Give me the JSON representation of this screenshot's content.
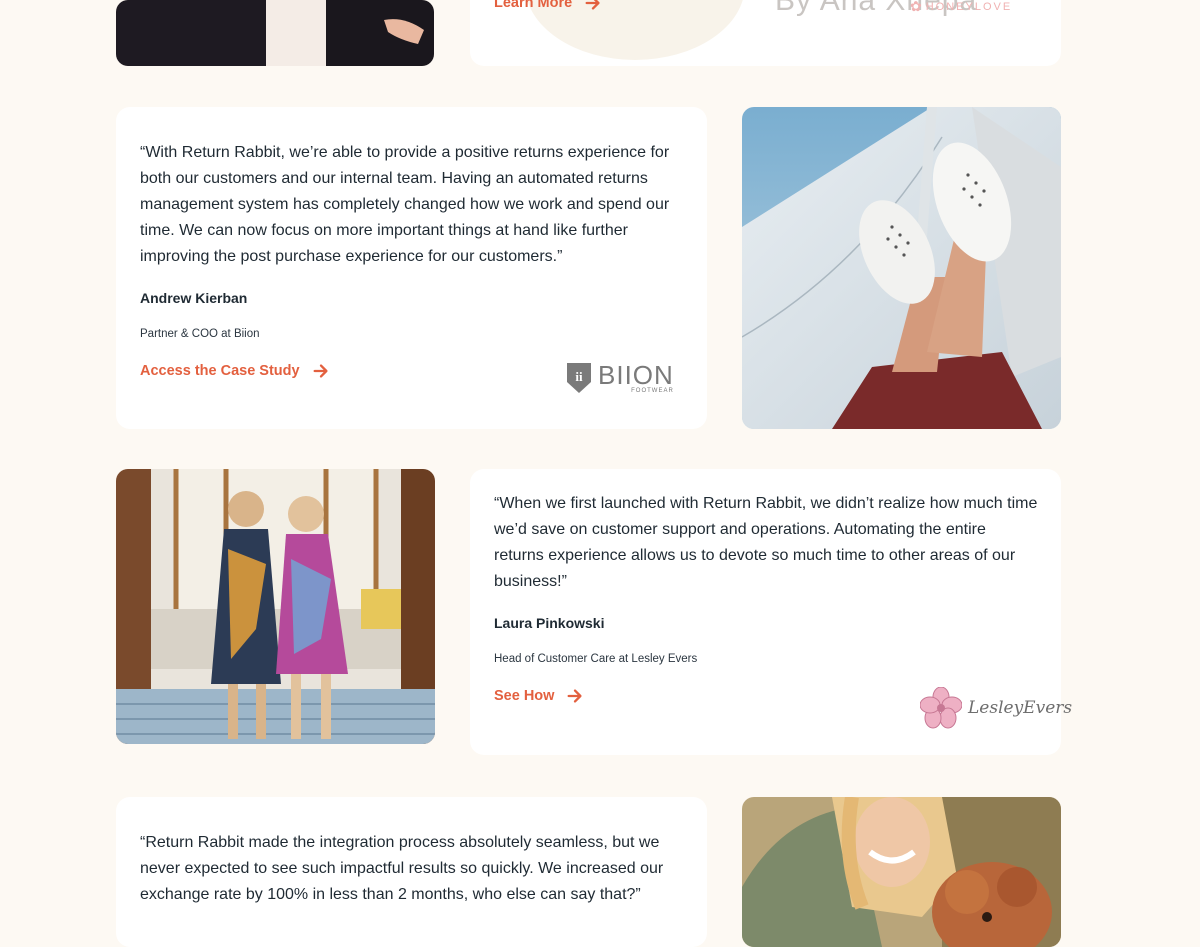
{
  "colors": {
    "accent": "#e3603f",
    "background": "#fdf9f3",
    "card": "#ffffff",
    "text": "#1f2a33"
  },
  "top_card": {
    "cta_label": "Learn More",
    "watermark": "By Ana Xhepa",
    "brand_logo": "HONEYLOVE"
  },
  "testimonials": [
    {
      "quote": "“With Return Rabbit, we’re able to provide a positive returns experience for both our customers and our internal team. Having an automated returns management system has completely changed how we work and spend our time. We can now focus on more important things at hand like further improving the post purchase experience for our customers.”",
      "name": "Andrew Kierban",
      "role": "Partner & COO at Biion",
      "cta_label": "Access the Case Study",
      "logo_text": "BIION",
      "logo_sub": "FOOTWEAR",
      "logo_mark": "ii",
      "photo": "white-slip-on-shoes-on-sailboat"
    },
    {
      "quote": "“When we first launched with Return Rabbit, we didn’t realize how much time we’d save on customer support and operations. Automating the entire returns experience allows us to devote so much time to other areas of our business!”",
      "name": "Laura Pinkowski",
      "role": "Head of Customer Care at Lesley Evers",
      "cta_label": "See How",
      "logo_text": "LesleyEvers",
      "photo": "two-women-in-patterned-dresses"
    },
    {
      "quote": "“Return Rabbit made the integration process absolutely seamless, but we never expected to see such impactful results so quickly. We increased our exchange rate by 100% in less than 2 months, who else can say that?”",
      "photo": "smiling-woman-with-dog"
    }
  ],
  "icons": {
    "arrow": "arrow-right-icon"
  }
}
